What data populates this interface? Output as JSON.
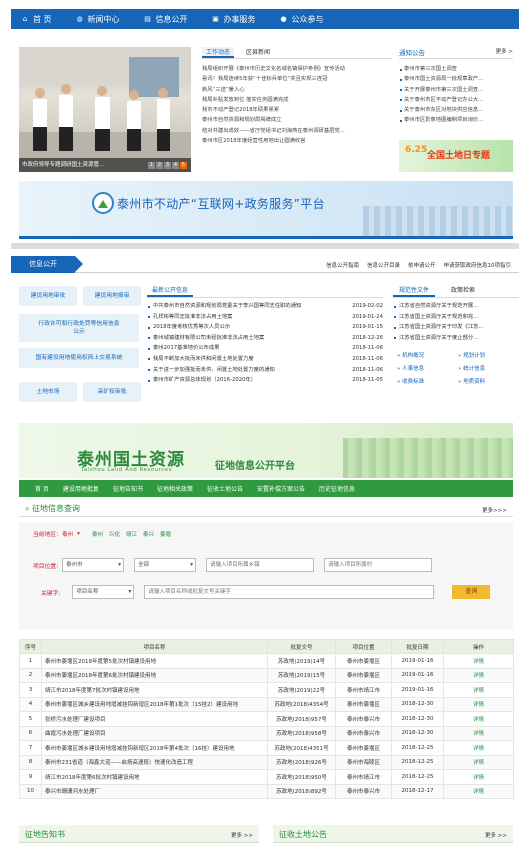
{
  "topnav": [
    {
      "icon": "home-icon",
      "glyph": "⌂",
      "label": "首 页"
    },
    {
      "icon": "globe-icon",
      "glyph": "◍",
      "label": "新闻中心"
    },
    {
      "icon": "document-icon",
      "glyph": "▤",
      "label": "信息公开"
    },
    {
      "icon": "briefcase-icon",
      "glyph": "▣",
      "label": "办事服务"
    },
    {
      "icon": "person-icon",
      "glyph": "●",
      "label": "公众参与"
    }
  ],
  "news": {
    "photo_caption": "市政府领导专题调研国土资源管...",
    "photo_pages": [
      "1",
      "2",
      "3",
      "4",
      "5"
    ],
    "tabs": [
      "工作动态",
      "区县新闻"
    ],
    "items": [
      "我局组织开展《泰州市历史文化名城名镇保护条例》宣传活动",
      "喜讯！我局连续5年获“十佳标兵单位”奖且实现三连冠",
      "新风“三送”暖人心",
      "我局补贴发放到位 落实任务圆满完成",
      "我市不动产登记2018年硕果累累",
      "泰州市自然资源和规划局揭牌成立",
      "结对共建出成效——省厅党组书记刘海燕在泰州调研基层党...",
      "泰州市区2018年度经营性用地出让圆满收官"
    ]
  },
  "notice": {
    "title": "通知公告",
    "more": "更多 >",
    "items": [
      "泰州市第三次国土调查",
      "泰州市国土资源局一批规章政产...",
      "关于开展泰州市第三次国土调查...",
      "关于泰州市区不动产登记办公大...",
      "关于泰州市东区对地块供应信息...",
      "泰州市区影像地图编制项目询价..."
    ],
    "promo_year": "6.25",
    "promo_text": "全国土地日专题"
  },
  "banner": {
    "title": "泰州市不动产“互联网+政务服务”平台"
  },
  "xxgk": {
    "label": "信息公开",
    "links": [
      "信息公开指南",
      "信息公开目录",
      "依申请公开",
      "申请获取政府信息10项指引"
    ],
    "buttons": [
      "建设用地审批",
      "建设用地报审",
      "行政许可和行政处罚等信用信息公示",
      "国有建设用地使用权网上交易系统",
      "土地市场",
      "采矿权审批"
    ],
    "mid_tab": "最新公开信息",
    "rows": [
      {
        "title": "中共泰州市自然资源和规划局党委关于李兴国等同志任职的通知",
        "date": "2019-02-02"
      },
      {
        "title": "孔祥彬等同志批准非法占用土地案",
        "date": "2019-01-24"
      },
      {
        "title": "2018年度考核优秀等次人员公示",
        "date": "2019-01-15"
      },
      {
        "title": "泰州城镇建材有限公司未经批准非法占用土地案",
        "date": "2018-12-26"
      },
      {
        "title": "泰州2017基准地价公布成果",
        "date": "2018-11-06"
      },
      {
        "title": "我局不断加大批而未供和闲置土地处置力度",
        "date": "2018-11-06"
      },
      {
        "title": "关于进一步加强批而未供、闲置土地处置力度的通知",
        "date": "2018-11-06"
      },
      {
        "title": "泰州市矿产资源总体规划（2016-2020年）",
        "date": "2018-11-05"
      }
    ],
    "right_tabs": [
      "规范性文件",
      "政策检索"
    ],
    "right_items": [
      "江苏省自然资源厅关于规范开展...",
      "江苏省国土资源厅关于规范和完...",
      "江苏省国土资源厅关于印发《江苏...",
      "江苏省国土资源厅关于度止部分..."
    ],
    "right_grid": [
      "» 机构概况",
      "» 规划计划",
      "» 人事信息",
      "» 统计信息",
      "» 收费标准",
      "» 地质资料"
    ]
  },
  "land": {
    "title": "泰州国土资源",
    "subtitle": "Taizhou Land And Resources",
    "platform": "征地信息公开平台",
    "nav": [
      "首 页",
      "建设用地批复",
      "征地告知书",
      "征地相关政策",
      "征收土地公告",
      "安置补偿方案公告",
      "历史征地信息"
    ],
    "query_title": "征地信息查询",
    "more": "更多>>>",
    "current_label": "当前地区:",
    "current_value": "泰州",
    "regions": [
      "泰州",
      "兴化",
      "靖江",
      "泰兴",
      "姜堰"
    ],
    "loc_label": "项目位置:",
    "loc_city": "泰州市",
    "loc_all": "全部",
    "loc_ph1": "请输入项目所属乡镇",
    "loc_ph2": "请输入项目所属村",
    "kw_label": "关键字:",
    "kw_sel": "项目名称",
    "kw_ph": "请输入项目名称或批复文号关键字",
    "search": "查询",
    "headers": [
      "序号",
      "项目名称",
      "批复文号",
      "项目位置",
      "批复日期",
      "操作"
    ],
    "rows": [
      [
        "1",
        "泰州市姜堰区2018年度第5批次村镇建设用地",
        "苏政地(2019)14号",
        "泰州市姜堰区",
        "2019-01-16",
        "详情"
      ],
      [
        "2",
        "泰州市姜堰区2018年度第6批次村镇建设用地",
        "苏政地(2019)15号",
        "泰州市姜堰区",
        "2019-01-16",
        "详情"
      ],
      [
        "3",
        "靖江市2018年度第7批次村镇建设用地",
        "苏政地(2019)22号",
        "泰州市靖江市",
        "2019-01-16",
        "详情"
      ],
      [
        "4",
        "泰州市姜堰区城乡建设用地增减挂钩新增区2018年第1批次（15挂2）建设用地",
        "苏政地(2018)4354号",
        "泰州市姜堰区",
        "2018-12-30",
        "详情"
      ],
      [
        "5",
        "张桥污水处理厂建设项目",
        "苏政地(2018)957号",
        "泰州市泰兴市",
        "2018-12-30",
        "详情"
      ],
      [
        "6",
        "曲霞污水处理厂建设项目",
        "苏政地(2018)958号",
        "泰州市泰兴市",
        "2018-12-30",
        "详情"
      ],
      [
        "7",
        "泰州市姜堰区城乡建设用地增减挂钩新增区2018年第4批次（16挂）建设用地",
        "苏政地(2018)4351号",
        "泰州市姜堰区",
        "2018-12-25",
        "详情"
      ],
      [
        "8",
        "泰州市231省道（海鑫大道——启扬高速段）快速化改造工程",
        "苏政地(2018)926号",
        "泰州市海陵区",
        "2018-12-25",
        "详情"
      ],
      [
        "9",
        "靖江市2018年度第6批次村镇建设用地",
        "苏政地(2018)950号",
        "泰州市靖江市",
        "2018-12-25",
        "详情"
      ],
      [
        "10",
        "泰兴市珊珊河水处理厂",
        "苏政地(2018)892号",
        "泰州市泰兴市",
        "2018-12-17",
        "详情"
      ]
    ],
    "foot_left": "征地告知书",
    "foot_right": "征收土地公告",
    "foot_more": "更多 >>"
  }
}
